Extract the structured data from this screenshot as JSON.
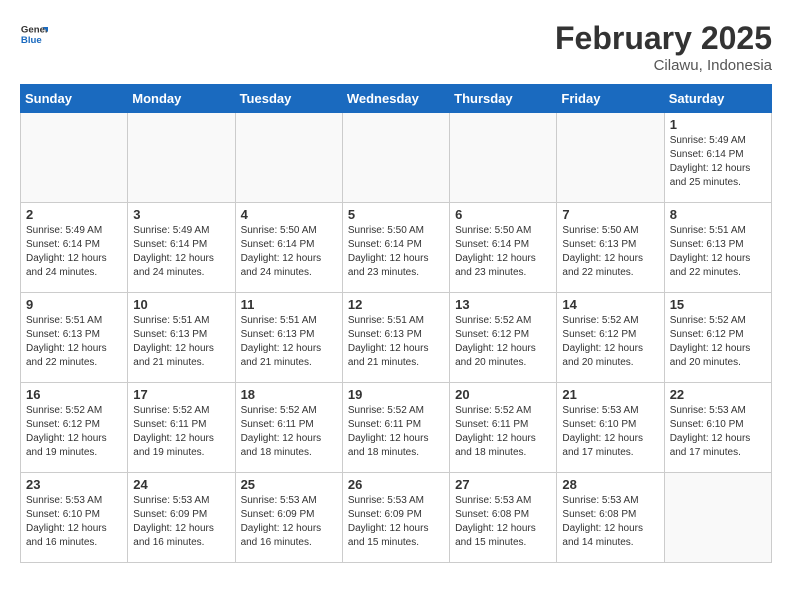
{
  "header": {
    "logo": {
      "general": "General",
      "blue": "Blue"
    },
    "month_title": "February 2025",
    "location": "Cilawu, Indonesia"
  },
  "weekdays": [
    "Sunday",
    "Monday",
    "Tuesday",
    "Wednesday",
    "Thursday",
    "Friday",
    "Saturday"
  ],
  "weeks": [
    [
      {
        "day": "",
        "info": ""
      },
      {
        "day": "",
        "info": ""
      },
      {
        "day": "",
        "info": ""
      },
      {
        "day": "",
        "info": ""
      },
      {
        "day": "",
        "info": ""
      },
      {
        "day": "",
        "info": ""
      },
      {
        "day": "1",
        "info": "Sunrise: 5:49 AM\nSunset: 6:14 PM\nDaylight: 12 hours\nand 25 minutes."
      }
    ],
    [
      {
        "day": "2",
        "info": "Sunrise: 5:49 AM\nSunset: 6:14 PM\nDaylight: 12 hours\nand 24 minutes."
      },
      {
        "day": "3",
        "info": "Sunrise: 5:49 AM\nSunset: 6:14 PM\nDaylight: 12 hours\nand 24 minutes."
      },
      {
        "day": "4",
        "info": "Sunrise: 5:50 AM\nSunset: 6:14 PM\nDaylight: 12 hours\nand 24 minutes."
      },
      {
        "day": "5",
        "info": "Sunrise: 5:50 AM\nSunset: 6:14 PM\nDaylight: 12 hours\nand 23 minutes."
      },
      {
        "day": "6",
        "info": "Sunrise: 5:50 AM\nSunset: 6:14 PM\nDaylight: 12 hours\nand 23 minutes."
      },
      {
        "day": "7",
        "info": "Sunrise: 5:50 AM\nSunset: 6:13 PM\nDaylight: 12 hours\nand 22 minutes."
      },
      {
        "day": "8",
        "info": "Sunrise: 5:51 AM\nSunset: 6:13 PM\nDaylight: 12 hours\nand 22 minutes."
      }
    ],
    [
      {
        "day": "9",
        "info": "Sunrise: 5:51 AM\nSunset: 6:13 PM\nDaylight: 12 hours\nand 22 minutes."
      },
      {
        "day": "10",
        "info": "Sunrise: 5:51 AM\nSunset: 6:13 PM\nDaylight: 12 hours\nand 21 minutes."
      },
      {
        "day": "11",
        "info": "Sunrise: 5:51 AM\nSunset: 6:13 PM\nDaylight: 12 hours\nand 21 minutes."
      },
      {
        "day": "12",
        "info": "Sunrise: 5:51 AM\nSunset: 6:13 PM\nDaylight: 12 hours\nand 21 minutes."
      },
      {
        "day": "13",
        "info": "Sunrise: 5:52 AM\nSunset: 6:12 PM\nDaylight: 12 hours\nand 20 minutes."
      },
      {
        "day": "14",
        "info": "Sunrise: 5:52 AM\nSunset: 6:12 PM\nDaylight: 12 hours\nand 20 minutes."
      },
      {
        "day": "15",
        "info": "Sunrise: 5:52 AM\nSunset: 6:12 PM\nDaylight: 12 hours\nand 20 minutes."
      }
    ],
    [
      {
        "day": "16",
        "info": "Sunrise: 5:52 AM\nSunset: 6:12 PM\nDaylight: 12 hours\nand 19 minutes."
      },
      {
        "day": "17",
        "info": "Sunrise: 5:52 AM\nSunset: 6:11 PM\nDaylight: 12 hours\nand 19 minutes."
      },
      {
        "day": "18",
        "info": "Sunrise: 5:52 AM\nSunset: 6:11 PM\nDaylight: 12 hours\nand 18 minutes."
      },
      {
        "day": "19",
        "info": "Sunrise: 5:52 AM\nSunset: 6:11 PM\nDaylight: 12 hours\nand 18 minutes."
      },
      {
        "day": "20",
        "info": "Sunrise: 5:52 AM\nSunset: 6:11 PM\nDaylight: 12 hours\nand 18 minutes."
      },
      {
        "day": "21",
        "info": "Sunrise: 5:53 AM\nSunset: 6:10 PM\nDaylight: 12 hours\nand 17 minutes."
      },
      {
        "day": "22",
        "info": "Sunrise: 5:53 AM\nSunset: 6:10 PM\nDaylight: 12 hours\nand 17 minutes."
      }
    ],
    [
      {
        "day": "23",
        "info": "Sunrise: 5:53 AM\nSunset: 6:10 PM\nDaylight: 12 hours\nand 16 minutes."
      },
      {
        "day": "24",
        "info": "Sunrise: 5:53 AM\nSunset: 6:09 PM\nDaylight: 12 hours\nand 16 minutes."
      },
      {
        "day": "25",
        "info": "Sunrise: 5:53 AM\nSunset: 6:09 PM\nDaylight: 12 hours\nand 16 minutes."
      },
      {
        "day": "26",
        "info": "Sunrise: 5:53 AM\nSunset: 6:09 PM\nDaylight: 12 hours\nand 15 minutes."
      },
      {
        "day": "27",
        "info": "Sunrise: 5:53 AM\nSunset: 6:08 PM\nDaylight: 12 hours\nand 15 minutes."
      },
      {
        "day": "28",
        "info": "Sunrise: 5:53 AM\nSunset: 6:08 PM\nDaylight: 12 hours\nand 14 minutes."
      },
      {
        "day": "",
        "info": ""
      }
    ]
  ]
}
